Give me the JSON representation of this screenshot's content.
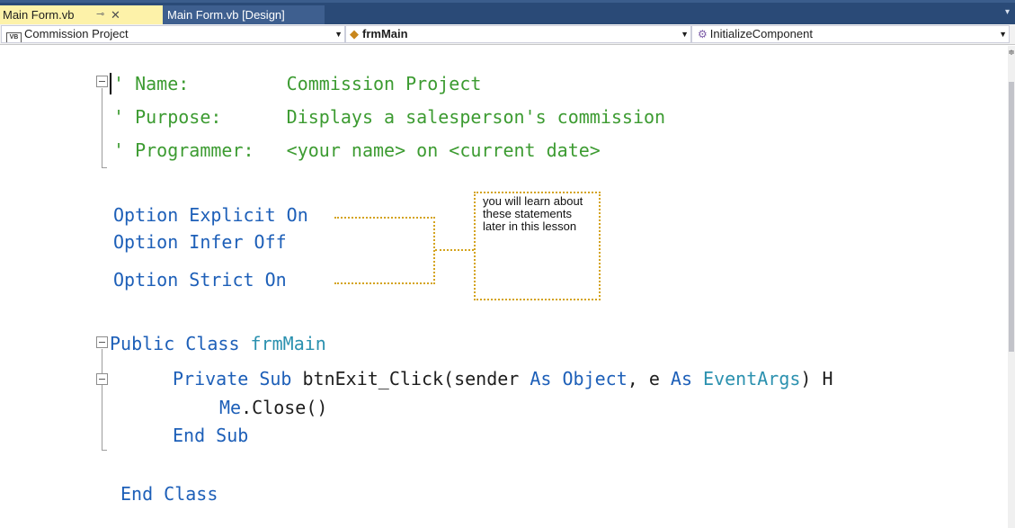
{
  "tabs": {
    "active_label": "Main Form.vb",
    "pin_glyph": "⊸",
    "close_glyph": "✕",
    "design_label": "Main Form.vb [Design]"
  },
  "navbar": {
    "project": "Commission Project",
    "project_icon_text": "VB",
    "class": "frmMain",
    "member": "InitializeComponent"
  },
  "code": {
    "comment_name": "' Name:         Commission Project",
    "comment_purpose": "' Purpose:      Displays a salesperson's commission",
    "comment_programmer": "' Programmer:   <your name> on <current date>",
    "opt_explicit_kw": "Option Explicit On",
    "opt_infer_kw": "Option Infer Off",
    "opt_strict_kw": "Option Strict On",
    "class_kw": "Public Class ",
    "class_name": "frmMain",
    "sub_kw": "Private Sub ",
    "sub_name": "btnExit_Click(sender ",
    "as1": "As ",
    "object_type": "Object",
    "param2": ", e ",
    "as2": "As ",
    "eventargs_type": "EventArgs",
    "after_args": ") H",
    "me_kw": "Me",
    "close_call": ".Close()",
    "end_sub": "End Sub",
    "end_class": "End Class"
  },
  "callout": {
    "text": "you will learn about these statements later in this lesson"
  },
  "colors": {
    "comment": "#3c9b31",
    "keyword": "#1d5fb8",
    "type": "#2b91af",
    "callout_border": "#d4a31c",
    "active_tab": "#fdf2a9"
  }
}
